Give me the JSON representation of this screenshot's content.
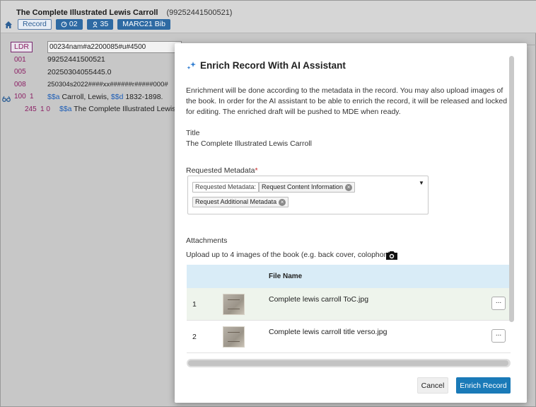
{
  "record": {
    "title": "The Complete Illustrated Lewis Carroll",
    "id": "(99252441500521)",
    "tabs": [
      {
        "label": "Record"
      },
      {
        "label": "02"
      },
      {
        "label": "35"
      },
      {
        "label": "MARC21 Bib"
      }
    ]
  },
  "marc": {
    "ldr_tag": "LDR",
    "ldr_value": "00234nam#a2200085#u#4500",
    "fields": [
      {
        "tag": "001",
        "ind": "",
        "value": "99252441500521"
      },
      {
        "tag": "005",
        "ind": "",
        "value": "20250304055445.0"
      },
      {
        "tag": "008",
        "ind": "",
        "value": "250304s2022####xx######r#####000#"
      },
      {
        "tag": "100",
        "ind": "1",
        "sub1": "$$a",
        "text1": " Carroll, Lewis, ",
        "sub2": "$$d",
        "text2": " 1832-1898."
      },
      {
        "tag": "245",
        "ind": "1  0",
        "sub1": "$$a",
        "text1": " The Complete Illustrated Lewis Carr"
      }
    ]
  },
  "modal": {
    "title": "Enrich Record With AI Assistant",
    "description": "Enrichment will be done according to the metadata in the record. You may also upload images of the book. In order for the AI assistant to be able to enrich the record, it will be released and locked for editing. The enriched draft will be pushed to MDE when ready.",
    "title_label": "Title",
    "title_value": "The Complete Illustrated Lewis Carroll",
    "requested_label": "Requested Metadata",
    "required_mark": "*",
    "chip_prefix": "Requested Metadata:",
    "chips": [
      "Request Content Information",
      "Request Additional Metadata"
    ],
    "attachments_label": "Attachments",
    "upload_hint": "Upload up to 4 images of the book (e.g. back cover, colophon)",
    "table_header": "File Name",
    "files": [
      {
        "num": "1",
        "name": "Complete lewis carroll ToC.jpg"
      },
      {
        "num": "2",
        "name": "Complete lewis carroll title verso.jpg"
      }
    ],
    "more_label": "...",
    "cancel_label": "Cancel",
    "enrich_label": "Enrich Record"
  },
  "colors": {
    "accent": "#1a7ab8",
    "table_header_bg": "#d9ecf7",
    "marc_tag": "#8b1f64",
    "subfield": "#1f5fb7"
  },
  "icons": [
    "home-icon",
    "clipboard-icon",
    "person-icon",
    "glasses-icon",
    "sparkle-icon",
    "camera-icon",
    "chip-remove-icon",
    "caret-down-icon"
  ]
}
